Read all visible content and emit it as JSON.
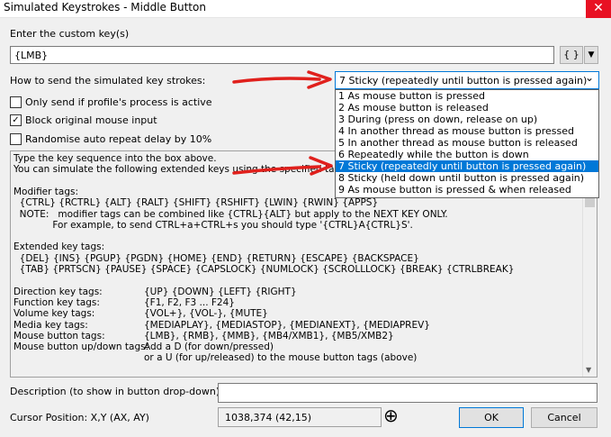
{
  "window": {
    "title": "Simulated Keystrokes - Middle Button",
    "close_glyph": "✕"
  },
  "custom_key": {
    "label": "Enter the custom key(s)",
    "value": "{LMB}",
    "braces_button": "{ }",
    "menu_arrow": "▼"
  },
  "send_mode": {
    "label": "How to send the simulated key strokes:",
    "selected": "7 Sticky (repeatedly until button is pressed again)",
    "chevron": "⌄",
    "options": [
      "1 As mouse button is pressed",
      "2 As mouse button is released",
      "3 During (press on down, release on up)",
      "4 In another thread as mouse button is pressed",
      "5 In another thread as mouse button is released",
      "6 Repeatedly while the button is down",
      "7 Sticky (repeatedly until button is pressed again)",
      "8 Sticky (held down until button is pressed again)",
      "9 As mouse button is pressed & when released"
    ],
    "selected_index": 6
  },
  "options": {
    "only_send": {
      "label": "Only send if profile's process is active",
      "checked": false
    },
    "block": {
      "label": "Block original mouse input",
      "checked": true,
      "check_glyph": "✓"
    },
    "randomise": {
      "label": "Randomise auto repeat delay by 10%",
      "checked": false
    }
  },
  "help": {
    "lines": [
      "Type the key sequence into the box above.",
      "You can simulate the following extended keys using the specified tags:",
      "",
      "Modifier tags:",
      "  {CTRL} {RCTRL} {ALT} {RALT} {SHIFT} {RSHIFT} {LWIN} {RWIN} {APPS}",
      "  NOTE:   modifier tags can be combined like {CTRL}{ALT} but apply to the NEXT KEY ONLY.",
      "             For example, to send CTRL+a+CTRL+s you should type '{CTRL}A{CTRL}S'.",
      "",
      "Extended key tags:",
      "  {DEL} {INS} {PGUP} {PGDN} {HOME} {END} {RETURN} {ESCAPE} {BACKSPACE}",
      "  {TAB} {PRTSCN} {PAUSE} {SPACE} {CAPSLOCK} {NUMLOCK} {SCROLLLOCK} {BREAK} {CTRLBREAK}",
      ""
    ],
    "table": [
      {
        "k": "Direction key tags:",
        "v": "{UP} {DOWN} {LEFT} {RIGHT}"
      },
      {
        "k": "Function key tags:",
        "v": "{F1, F2, F3 ... F24}"
      },
      {
        "k": "Volume key tags:",
        "v": "{VOL+}, {VOL-}, {MUTE}"
      },
      {
        "k": "Media key tags:",
        "v": "{MEDIAPLAY}, {MEDIASTOP}, {MEDIANEXT}, {MEDIAPREV}"
      },
      {
        "k": "Mouse button tags:",
        "v": "{LMB}, {RMB}, {MMB}, {MB4/XMB1}, {MB5/XMB2}"
      },
      {
        "k": "Mouse button up/down tags:",
        "v": "Add a D (for down/pressed)"
      },
      {
        "k": "",
        "v": "or a U (for up/released) to the mouse button tags (above)"
      }
    ]
  },
  "description": {
    "label": "Description (to show in button drop-down)",
    "value": ""
  },
  "cursor": {
    "label": "Cursor Position: X,Y (AX, AY)",
    "value": "1038,374 (42,15)",
    "target_glyph": "⊕"
  },
  "buttons": {
    "ok": "OK",
    "cancel": "Cancel"
  },
  "colors": {
    "accent": "#0078d7",
    "annotation": "#e0201c",
    "close": "#e81123"
  }
}
